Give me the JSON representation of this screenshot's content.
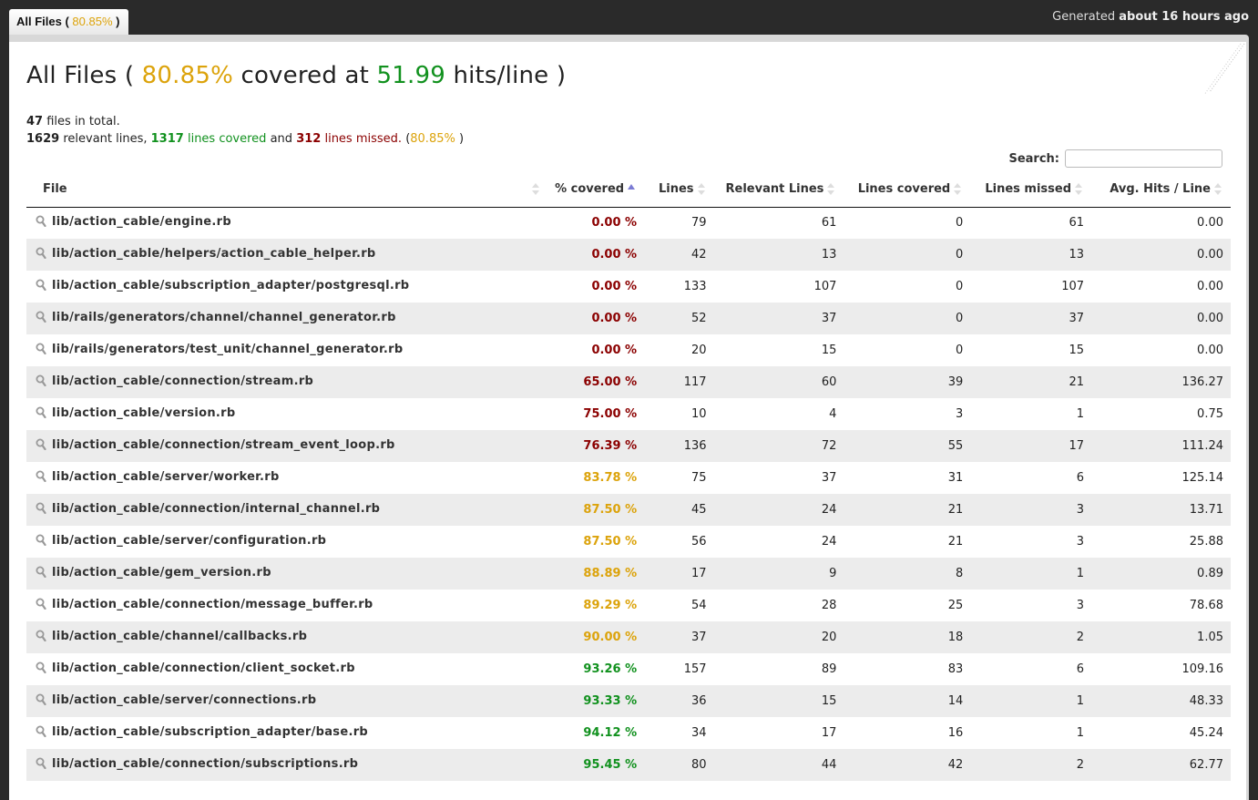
{
  "tab": {
    "label": "All Files (",
    "percent": "80.85%",
    "suffix": ")"
  },
  "generated": {
    "prefix": "Generated",
    "when": "about 16 hours ago"
  },
  "title": {
    "prefix": "All Files (",
    "percent": "80.85%",
    "middle": "covered at",
    "hits": "51.99",
    "suffix": "hits/line )"
  },
  "summary": {
    "files_count": "47",
    "files_text": "files in total.",
    "relevant": "1629",
    "relevant_text": "relevant lines,",
    "covered": "1317",
    "covered_text": "lines covered",
    "and_text": "and",
    "missed": "312",
    "missed_text": "lines missed.",
    "percent_open": "(",
    "percent": "80.85%",
    "percent_close": ")"
  },
  "search": {
    "label": "Search:",
    "value": "",
    "placeholder": ""
  },
  "colors": {
    "yellow": "#dca30b",
    "green": "#11911e",
    "red": "#8b0000"
  },
  "columns": [
    "File",
    "% covered",
    "Lines",
    "Relevant Lines",
    "Lines covered",
    "Lines missed",
    "Avg. Hits / Line"
  ],
  "sorted_column": "% covered",
  "sort_direction": "ascending",
  "rows": [
    {
      "file": "lib/action_cable/engine.rb",
      "covered": "0.00 %",
      "level": "red",
      "lines": "79",
      "relevant": "61",
      "lines_covered": "0",
      "missed": "61",
      "avg": "0.00"
    },
    {
      "file": "lib/action_cable/helpers/action_cable_helper.rb",
      "covered": "0.00 %",
      "level": "red",
      "lines": "42",
      "relevant": "13",
      "lines_covered": "0",
      "missed": "13",
      "avg": "0.00"
    },
    {
      "file": "lib/action_cable/subscription_adapter/postgresql.rb",
      "covered": "0.00 %",
      "level": "red",
      "lines": "133",
      "relevant": "107",
      "lines_covered": "0",
      "missed": "107",
      "avg": "0.00"
    },
    {
      "file": "lib/rails/generators/channel/channel_generator.rb",
      "covered": "0.00 %",
      "level": "red",
      "lines": "52",
      "relevant": "37",
      "lines_covered": "0",
      "missed": "37",
      "avg": "0.00"
    },
    {
      "file": "lib/rails/generators/test_unit/channel_generator.rb",
      "covered": "0.00 %",
      "level": "red",
      "lines": "20",
      "relevant": "15",
      "lines_covered": "0",
      "missed": "15",
      "avg": "0.00"
    },
    {
      "file": "lib/action_cable/connection/stream.rb",
      "covered": "65.00 %",
      "level": "red",
      "lines": "117",
      "relevant": "60",
      "lines_covered": "39",
      "missed": "21",
      "avg": "136.27"
    },
    {
      "file": "lib/action_cable/version.rb",
      "covered": "75.00 %",
      "level": "red",
      "lines": "10",
      "relevant": "4",
      "lines_covered": "3",
      "missed": "1",
      "avg": "0.75"
    },
    {
      "file": "lib/action_cable/connection/stream_event_loop.rb",
      "covered": "76.39 %",
      "level": "red",
      "lines": "136",
      "relevant": "72",
      "lines_covered": "55",
      "missed": "17",
      "avg": "111.24"
    },
    {
      "file": "lib/action_cable/server/worker.rb",
      "covered": "83.78 %",
      "level": "yellow",
      "lines": "75",
      "relevant": "37",
      "lines_covered": "31",
      "missed": "6",
      "avg": "125.14"
    },
    {
      "file": "lib/action_cable/connection/internal_channel.rb",
      "covered": "87.50 %",
      "level": "yellow",
      "lines": "45",
      "relevant": "24",
      "lines_covered": "21",
      "missed": "3",
      "avg": "13.71"
    },
    {
      "file": "lib/action_cable/server/configuration.rb",
      "covered": "87.50 %",
      "level": "yellow",
      "lines": "56",
      "relevant": "24",
      "lines_covered": "21",
      "missed": "3",
      "avg": "25.88"
    },
    {
      "file": "lib/action_cable/gem_version.rb",
      "covered": "88.89 %",
      "level": "yellow",
      "lines": "17",
      "relevant": "9",
      "lines_covered": "8",
      "missed": "1",
      "avg": "0.89"
    },
    {
      "file": "lib/action_cable/connection/message_buffer.rb",
      "covered": "89.29 %",
      "level": "yellow",
      "lines": "54",
      "relevant": "28",
      "lines_covered": "25",
      "missed": "3",
      "avg": "78.68"
    },
    {
      "file": "lib/action_cable/channel/callbacks.rb",
      "covered": "90.00 %",
      "level": "yellow",
      "lines": "37",
      "relevant": "20",
      "lines_covered": "18",
      "missed": "2",
      "avg": "1.05"
    },
    {
      "file": "lib/action_cable/connection/client_socket.rb",
      "covered": "93.26 %",
      "level": "green",
      "lines": "157",
      "relevant": "89",
      "lines_covered": "83",
      "missed": "6",
      "avg": "109.16"
    },
    {
      "file": "lib/action_cable/server/connections.rb",
      "covered": "93.33 %",
      "level": "green",
      "lines": "36",
      "relevant": "15",
      "lines_covered": "14",
      "missed": "1",
      "avg": "48.33"
    },
    {
      "file": "lib/action_cable/subscription_adapter/base.rb",
      "covered": "94.12 %",
      "level": "green",
      "lines": "34",
      "relevant": "17",
      "lines_covered": "16",
      "missed": "1",
      "avg": "45.24"
    },
    {
      "file": "lib/action_cable/connection/subscriptions.rb",
      "covered": "95.45 %",
      "level": "green",
      "lines": "80",
      "relevant": "44",
      "lines_covered": "42",
      "missed": "2",
      "avg": "62.77"
    }
  ]
}
